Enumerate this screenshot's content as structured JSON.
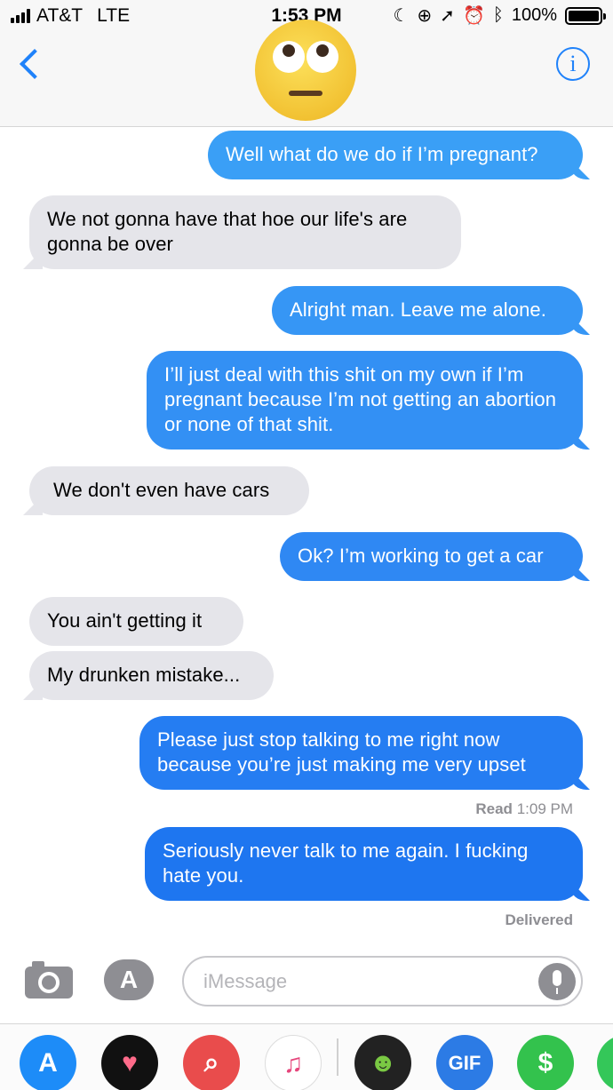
{
  "status_bar": {
    "carrier": "AT&T",
    "network": "LTE",
    "time": "1:53 PM",
    "battery": "100%",
    "icons": [
      "do-not-disturb-icon",
      "orientation-lock-icon",
      "location-icon",
      "alarm-icon",
      "bluetooth-icon",
      "battery-icon"
    ]
  },
  "header": {
    "back_icon": "chevron-left-icon",
    "contact_avatar": "face-with-rolling-eyes-emoji",
    "info_label": "i"
  },
  "messages": [
    {
      "direction": "outgoing",
      "text": "Well what do we do if I’m pregnant?",
      "color": "#3a9ff6"
    },
    {
      "direction": "incoming",
      "text": "We not gonna have that hoe our life's are gonna be over"
    },
    {
      "direction": "outgoing",
      "text": "Alright man. Leave me alone.",
      "color": "#3696f5"
    },
    {
      "direction": "outgoing",
      "text": "I’ll just deal with this shit on my own if I’m pregnant because I’m not getting an abortion or none of that shit.",
      "color": "#3390f4"
    },
    {
      "direction": "incoming",
      "text": "We don't even have cars"
    },
    {
      "direction": "outgoing",
      "text": "Ok? I’m working to get a car",
      "color": "#2f88f3"
    },
    {
      "direction": "incoming",
      "text": "You ain't getting it"
    },
    {
      "direction": "incoming",
      "text": "My drunken mistake..."
    },
    {
      "direction": "outgoing",
      "text": "Please just stop talking to me right now because you’re just making me very upset",
      "color": "#257df2"
    },
    {
      "direction": "outgoing",
      "text": "Seriously never talk to me again. I fucking hate you.",
      "color": "#1e76f0"
    }
  ],
  "receipts": {
    "read_label": "Read",
    "read_time": "1:09 PM",
    "delivered": "Delivered"
  },
  "input_bar": {
    "camera_icon": "camera-icon",
    "apps_icon": "app-store-icon",
    "placeholder": "iMessage",
    "mic_icon": "microphone-icon"
  },
  "app_drawer": [
    {
      "name": "app-store",
      "glyph": "A",
      "color": "#1d8cf8"
    },
    {
      "name": "digital-touch",
      "glyph": "♥",
      "color": "#111111"
    },
    {
      "name": "images-search",
      "glyph": "⌕",
      "color": "#e94c4c"
    },
    {
      "name": "music",
      "glyph": "♫",
      "color": "#ffffff"
    },
    {
      "name": "game",
      "glyph": "☻",
      "color": "#222222"
    },
    {
      "name": "gif",
      "glyph": "GIF",
      "color": "#2c7be5"
    },
    {
      "name": "apple-pay-cash",
      "glyph": "$",
      "color": "#33c24d"
    },
    {
      "name": "more-apps",
      "glyph": "",
      "color": "#34c759"
    }
  ]
}
